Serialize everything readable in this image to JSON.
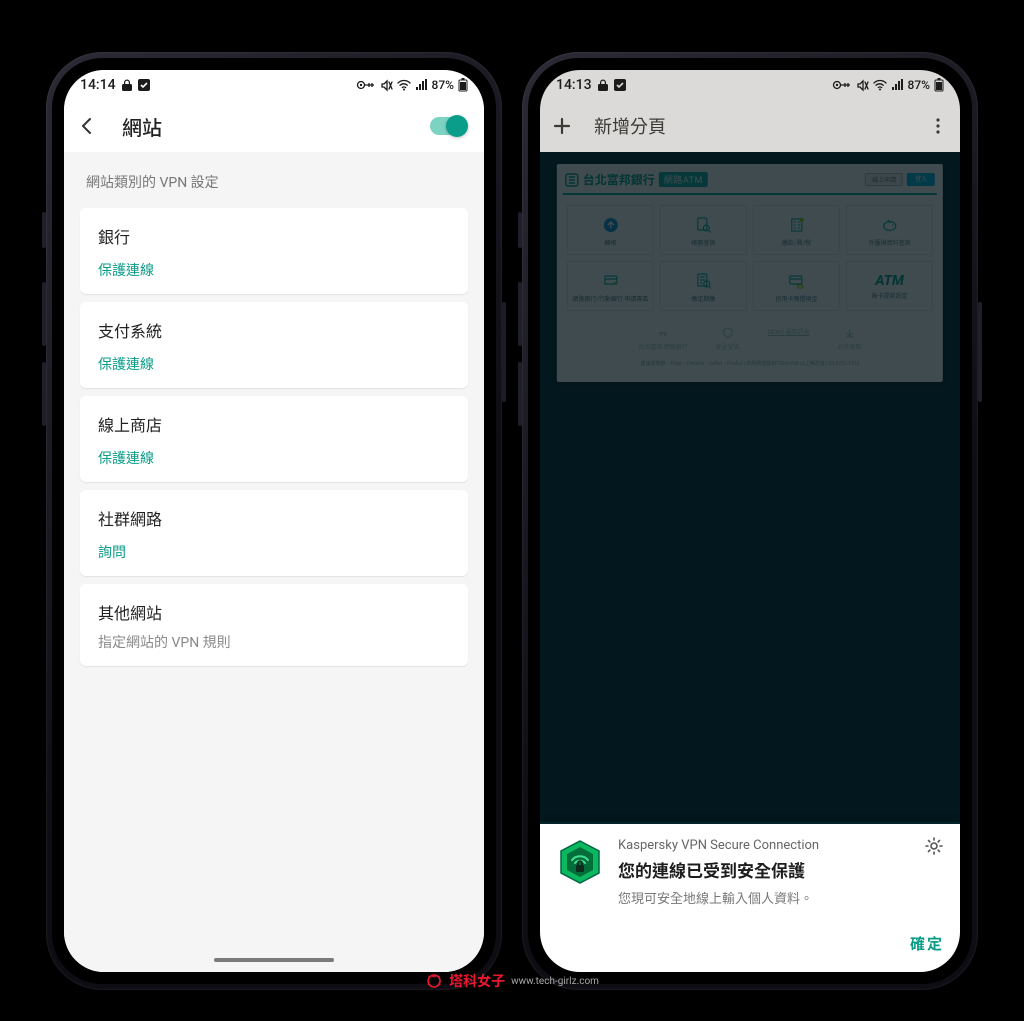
{
  "left": {
    "status": {
      "time": "14:14",
      "battery": "87%"
    },
    "appbar": {
      "title": "網站"
    },
    "section_caption": "網站類別的 VPN 設定",
    "cards": [
      {
        "title": "銀行",
        "sub": "保護連線",
        "muted": ""
      },
      {
        "title": "支付系統",
        "sub": "保護連線",
        "muted": ""
      },
      {
        "title": "線上商店",
        "sub": "保護連線",
        "muted": ""
      },
      {
        "title": "社群網路",
        "sub": "詢問",
        "muted": ""
      },
      {
        "title": "其他網站",
        "sub": "",
        "muted": "指定網站的 VPN 規則"
      }
    ]
  },
  "right": {
    "status": {
      "time": "14:13",
      "battery": "87%"
    },
    "browser": {
      "title": "新增分頁"
    },
    "bank": {
      "brand": "台北富邦銀行",
      "tag": "網路ATM",
      "btn1": "線上申請",
      "btn2": "登入",
      "tiles": [
        "轉帳",
        "帳務查詢",
        "繳款/費/稅",
        "外匯與資料查詢",
        "網路銀行/行動銀行 申請專區",
        "繳定期繳",
        "信用卡預借現金",
        ""
      ],
      "atm_label": "ATM",
      "atm_sub": "無卡提款設定",
      "links": [
        "台北富邦 網路銀行",
        "安全宣告",
        "NEWS 最新訊息",
        "元件安裝"
      ],
      "fine": "建議瀏覽器：Edge、Chrome、Safari、Firefox | 本服務僅提供1024×768 以上解析度 | 02-8751-1313"
    },
    "toast": {
      "app": "Kaspersky VPN Secure Connection",
      "title": "您的連線已受到安全保護",
      "sub": "您現可安全地線上輸入個人資料。",
      "confirm": "確定"
    }
  },
  "watermark": {
    "zh": "塔科女子",
    "en": "www.tech-girlz.com"
  },
  "colors": {
    "accent": "#0b9c88"
  }
}
